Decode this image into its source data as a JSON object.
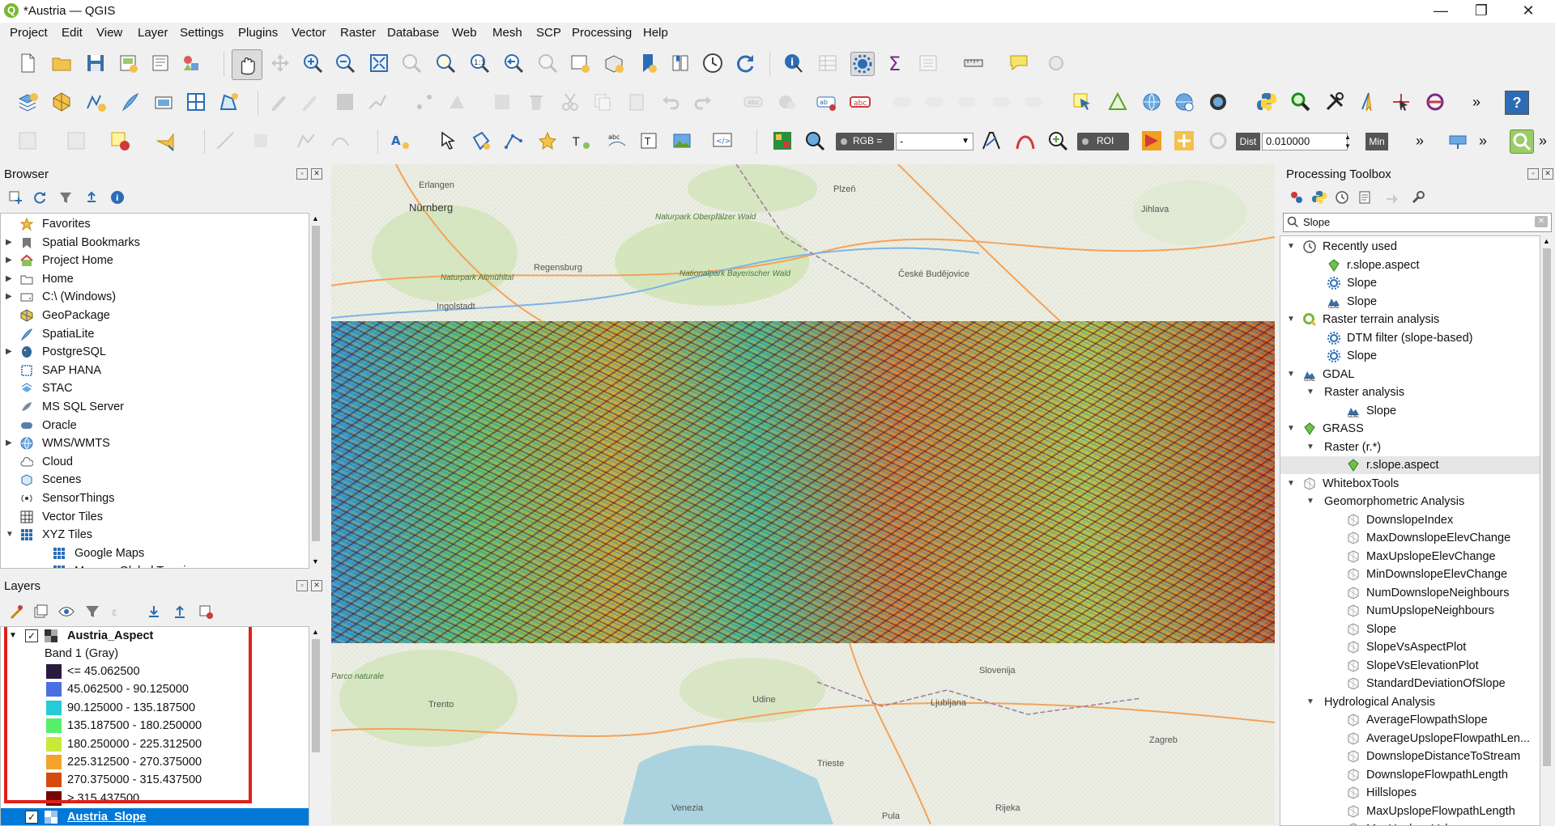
{
  "window": {
    "title": "*Austria — QGIS",
    "logo": "Q"
  },
  "window_controls": {
    "minimize": "—",
    "maximize": "❐",
    "close": "✕"
  },
  "menu": [
    "Project",
    "Edit",
    "View",
    "Layer",
    "Settings",
    "Plugins",
    "Vector",
    "Raster",
    "Database",
    "Web",
    "Mesh",
    "SCP",
    "Processing",
    "Help"
  ],
  "toolbar3": {
    "rgb_label": "RGB =",
    "rgb_value": "-",
    "roi_label": "ROI",
    "dist_label": "Dist",
    "dist_value": "0.010000",
    "min_label": "Min",
    "overflow": "»"
  },
  "browser": {
    "title": "Browser",
    "items": [
      {
        "label": "Favorites",
        "icon": "star-icon",
        "expandable": false
      },
      {
        "label": "Spatial Bookmarks",
        "icon": "bookmark-icon",
        "expandable": true
      },
      {
        "label": "Project Home",
        "icon": "project-home-icon",
        "expandable": true
      },
      {
        "label": "Home",
        "icon": "home-folder-icon",
        "expandable": true
      },
      {
        "label": "C:\\ (Windows)",
        "icon": "drive-icon",
        "expandable": true
      },
      {
        "label": "GeoPackage",
        "icon": "geopackage-icon",
        "expandable": false
      },
      {
        "label": "SpatiaLite",
        "icon": "spatialite-icon",
        "expandable": false
      },
      {
        "label": "PostgreSQL",
        "icon": "postgresql-icon",
        "expandable": true
      },
      {
        "label": "SAP HANA",
        "icon": "sap-hana-icon",
        "expandable": false
      },
      {
        "label": "STAC",
        "icon": "stac-icon",
        "expandable": false
      },
      {
        "label": "MS SQL Server",
        "icon": "mssql-icon",
        "expandable": false
      },
      {
        "label": "Oracle",
        "icon": "oracle-icon",
        "expandable": false
      },
      {
        "label": "WMS/WMTS",
        "icon": "globe-icon",
        "expandable": true
      },
      {
        "label": "Cloud",
        "icon": "cloud-icon",
        "expandable": false
      },
      {
        "label": "Scenes",
        "icon": "scenes-icon",
        "expandable": false
      },
      {
        "label": "SensorThings",
        "icon": "sensorthings-icon",
        "expandable": false
      },
      {
        "label": "Vector Tiles",
        "icon": "vector-tiles-icon",
        "expandable": false
      },
      {
        "label": "XYZ Tiles",
        "icon": "xyz-tiles-icon",
        "expandable": true,
        "expanded": true
      },
      {
        "label": "Google Maps",
        "icon": "xyz-tiles-icon",
        "child": true
      },
      {
        "label": "Mapzen Global Terrain",
        "icon": "xyz-tiles-icon",
        "child": true
      }
    ]
  },
  "layers": {
    "title": "Layers",
    "layer1": {
      "name": "Austria_Aspect",
      "band": "Band 1 (Gray)",
      "checked": true
    },
    "legend": [
      {
        "label": "<= 45.062500",
        "color": "#2b1a3d"
      },
      {
        "label": "45.062500 - 90.125000",
        "color": "#4a6fe3"
      },
      {
        "label": "90.125000 - 135.187500",
        "color": "#25cbd6"
      },
      {
        "label": "135.187500 - 180.250000",
        "color": "#57f06a"
      },
      {
        "label": "180.250000 - 225.312500",
        "color": "#c9e83a"
      },
      {
        "label": "225.312500 - 270.375000",
        "color": "#f3a22a"
      },
      {
        "label": "270.375000 - 315.437500",
        "color": "#d64a0d"
      },
      {
        "label": "> 315.437500",
        "color": "#7a0403"
      }
    ],
    "layer2": {
      "name": "Austria_Slope",
      "checked": true
    }
  },
  "map_labels": [
    "Erlangen",
    "Nürnberg",
    "Ingolstadt",
    "Regensburg",
    "Naturpark Altmühltal",
    "Nationalpark Bayerischer Wald",
    "Naturpark Oberpfälzer Wald",
    "České Budějovice",
    "Jihlava",
    "Plzeň",
    "Parco naturale",
    "Trento",
    "Udine",
    "Venezia",
    "Trieste",
    "Ljubljana",
    "Zagreb",
    "Slovenija",
    "Rijeka",
    "Pula"
  ],
  "toolbox": {
    "title": "Processing Toolbox",
    "search_value": "Slope",
    "tree": [
      {
        "label": "Recently used",
        "level": 0,
        "icon": "clock-icon",
        "arrow": "down"
      },
      {
        "label": "r.slope.aspect",
        "level": 1,
        "icon": "grass-icon"
      },
      {
        "label": "Slope",
        "level": 1,
        "icon": "gear-icon"
      },
      {
        "label": "Slope",
        "level": 1,
        "icon": "gdal-icon"
      },
      {
        "label": "Raster terrain analysis",
        "level": 0,
        "icon": "qgis-icon",
        "arrow": "down"
      },
      {
        "label": "DTM filter (slope-based)",
        "level": 1,
        "icon": "gear-icon"
      },
      {
        "label": "Slope",
        "level": 1,
        "icon": "gear-icon"
      },
      {
        "label": "GDAL",
        "level": 0,
        "icon": "gdal-icon",
        "arrow": "down"
      },
      {
        "label": "Raster analysis",
        "level": 1,
        "arrow": "down"
      },
      {
        "label": "Slope",
        "level": 2,
        "icon": "gdal-icon"
      },
      {
        "label": "GRASS",
        "level": 0,
        "icon": "grass-icon",
        "arrow": "down"
      },
      {
        "label": "Raster (r.*)",
        "level": 1,
        "arrow": "down"
      },
      {
        "label": "r.slope.aspect",
        "level": 2,
        "icon": "grass-icon",
        "selected": true
      },
      {
        "label": "WhiteboxTools",
        "level": 0,
        "icon": "whitebox-icon",
        "arrow": "down"
      },
      {
        "label": "Geomorphometric Analysis",
        "level": 1,
        "arrow": "down"
      },
      {
        "label": "DownslopeIndex",
        "level": 2,
        "icon": "whitebox-icon"
      },
      {
        "label": "MaxDownslopeElevChange",
        "level": 2,
        "icon": "whitebox-icon"
      },
      {
        "label": "MaxUpslopeElevChange",
        "level": 2,
        "icon": "whitebox-icon"
      },
      {
        "label": "MinDownslopeElevChange",
        "level": 2,
        "icon": "whitebox-icon"
      },
      {
        "label": "NumDownslopeNeighbours",
        "level": 2,
        "icon": "whitebox-icon"
      },
      {
        "label": "NumUpslopeNeighbours",
        "level": 2,
        "icon": "whitebox-icon"
      },
      {
        "label": "Slope",
        "level": 2,
        "icon": "whitebox-icon"
      },
      {
        "label": "SlopeVsAspectPlot",
        "level": 2,
        "icon": "whitebox-icon"
      },
      {
        "label": "SlopeVsElevationPlot",
        "level": 2,
        "icon": "whitebox-icon"
      },
      {
        "label": "StandardDeviationOfSlope",
        "level": 2,
        "icon": "whitebox-icon"
      },
      {
        "label": "Hydrological Analysis",
        "level": 1,
        "arrow": "down"
      },
      {
        "label": "AverageFlowpathSlope",
        "level": 2,
        "icon": "whitebox-icon"
      },
      {
        "label": "AverageUpslopeFlowpathLen...",
        "level": 2,
        "icon": "whitebox-icon"
      },
      {
        "label": "DownslopeDistanceToStream",
        "level": 2,
        "icon": "whitebox-icon"
      },
      {
        "label": "DownslopeFlowpathLength",
        "level": 2,
        "icon": "whitebox-icon"
      },
      {
        "label": "Hillslopes",
        "level": 2,
        "icon": "whitebox-icon"
      },
      {
        "label": "MaxUpslopeFlowpathLength",
        "level": 2,
        "icon": "whitebox-icon"
      },
      {
        "label": "MaxUpslopeValue",
        "level": 2,
        "icon": "whitebox-icon"
      }
    ]
  },
  "colors": {
    "accent": "#0078d7",
    "highlight_box": "#e0201b",
    "selected_layer": "#0078d7"
  }
}
